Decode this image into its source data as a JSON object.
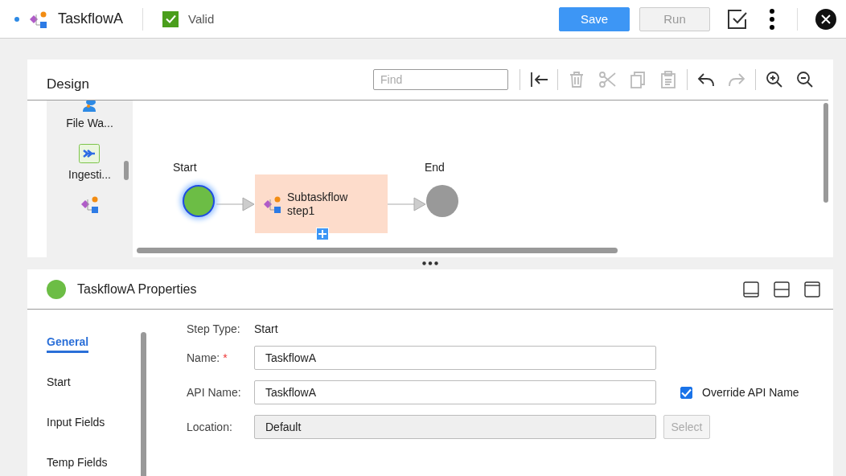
{
  "header": {
    "title": "TaskflowA",
    "validity": {
      "label": "Valid",
      "checked": true
    },
    "buttons": [
      {
        "label": "Save",
        "kind": "primary",
        "disabled": false
      },
      {
        "label": "Run",
        "kind": "secondary",
        "disabled": true
      }
    ]
  },
  "design": {
    "title": "Design",
    "find": {
      "placeholder": "Find"
    },
    "toolbar": [
      {
        "kind": "collapse",
        "disabled": false
      },
      {
        "kind": "delete",
        "disabled": true
      },
      {
        "kind": "cut",
        "disabled": true
      },
      {
        "kind": "copy",
        "disabled": true
      },
      {
        "kind": "paste",
        "disabled": true
      },
      {
        "kind": "undo",
        "disabled": false
      },
      {
        "kind": "redo",
        "disabled": true
      },
      {
        "kind": "zoom-in",
        "disabled": false
      },
      {
        "kind": "zoom-out",
        "disabled": false
      }
    ],
    "palette": [
      {
        "kind": "watch",
        "label": "File Wa..."
      },
      {
        "kind": "ingest",
        "label": "Ingesti..."
      },
      {
        "kind": "subtaskflow"
      }
    ],
    "nodes": [
      {
        "kind": "start",
        "label": "Start",
        "selected": true
      },
      {
        "kind": "step",
        "label": "Subtaskflow step1",
        "selected": false
      },
      {
        "kind": "end",
        "label": "End",
        "selected": false
      }
    ]
  },
  "properties": {
    "title": "TaskflowA Properties",
    "nav": [
      {
        "label": "General",
        "selected": true
      },
      {
        "label": "Start",
        "selected": false
      },
      {
        "label": "Input Fields",
        "selected": false
      },
      {
        "label": "Temp Fields",
        "selected": false
      }
    ],
    "step_type": {
      "label": "Step Type:",
      "value": "Start"
    },
    "fields": [
      {
        "label": "Name:",
        "required_mark": "*",
        "value": "TaskflowA",
        "disabled": false
      },
      {
        "label": "API Name:",
        "value": "TaskflowA",
        "disabled": false,
        "override": {
          "label": "Override API Name",
          "checked": true
        }
      },
      {
        "label": "Location:",
        "value": "Default",
        "disabled": true,
        "button": {
          "label": "Select",
          "disabled": true
        }
      }
    ]
  }
}
